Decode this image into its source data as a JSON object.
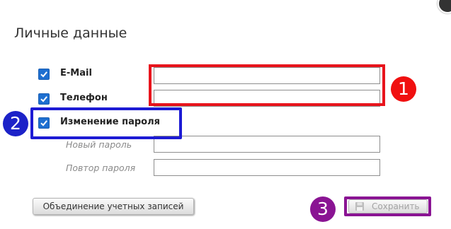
{
  "dialog": {
    "title": "Личные данные"
  },
  "form": {
    "email": {
      "label": "E-Mail",
      "checked": true,
      "value": ""
    },
    "phone": {
      "label": "Телефон",
      "checked": true,
      "value": ""
    },
    "change_password": {
      "label": "Изменение пароля",
      "checked": true
    },
    "new_password": {
      "label": "Новый пароль",
      "value": ""
    },
    "repeat_password": {
      "label": "Повтор пароля",
      "value": ""
    }
  },
  "buttons": {
    "merge_accounts": "Объединение учетных записей",
    "save": "Сохранить"
  },
  "annotations": {
    "badge_1": "1",
    "badge_2": "2",
    "badge_3": "3"
  },
  "colors": {
    "highlight_1": "#e8141c",
    "highlight_2": "#1d1bd4",
    "highlight_3": "#8a1493",
    "checkbox": "#1e6fd0"
  },
  "icons": {
    "close": "close-icon",
    "save": "floppy-disk-icon",
    "checkbox": "checkmark-icon"
  }
}
